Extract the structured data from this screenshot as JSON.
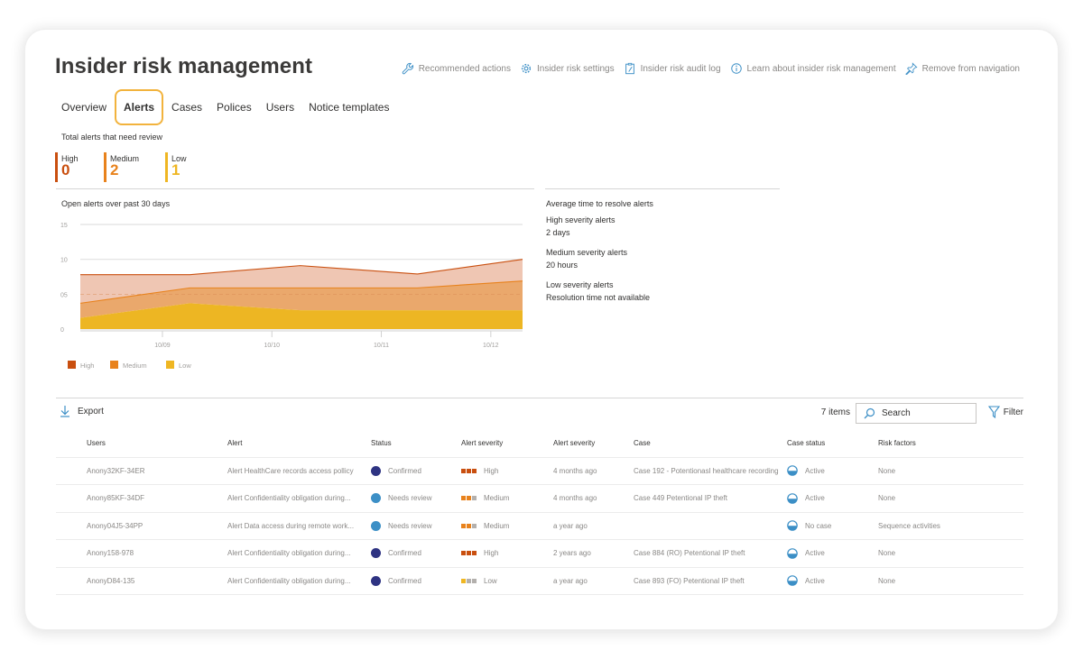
{
  "header": {
    "title": "Insider risk management",
    "actions": [
      {
        "label": "Recommended actions",
        "icon": "wrench-icon"
      },
      {
        "label": "Insider risk settings",
        "icon": "gear-icon"
      },
      {
        "label": "Insider risk audit log",
        "icon": "clipboard-icon"
      },
      {
        "label": "Learn about insider risk management",
        "icon": "info-icon"
      },
      {
        "label": "Remove from navigation",
        "icon": "pin-icon"
      }
    ]
  },
  "tabs": [
    {
      "label": "Overview",
      "active": false
    },
    {
      "label": "Alerts",
      "active": true
    },
    {
      "label": "Cases",
      "active": false
    },
    {
      "label": "Polices",
      "active": false
    },
    {
      "label": "Users",
      "active": false
    },
    {
      "label": "Notice templates",
      "active": false
    }
  ],
  "totals": {
    "title": "Total alerts that need review",
    "high": {
      "label": "High",
      "value": "0"
    },
    "medium": {
      "label": "Medium",
      "value": "2"
    },
    "low": {
      "label": "Low",
      "value": "1"
    }
  },
  "colors": {
    "high": "#c94f0f",
    "medium": "#e8821c",
    "low": "#efb622",
    "confirmed": "#2e3382",
    "needs_review": "#3c8fc6",
    "accent_tab": "#f2b33d"
  },
  "chart_data": {
    "type": "area",
    "stacked": true,
    "title": "Open alerts over past 30 days",
    "xlabel": "",
    "ylabel": "",
    "x_ticks": [
      "10/09",
      "10/10",
      "10/11",
      "10/12"
    ],
    "x_tick_days": [
      1,
      2,
      3,
      4
    ],
    "x": [
      0.25,
      1.25,
      2.26,
      3.33,
      4.29
    ],
    "xlim": [
      0.25,
      4.29
    ],
    "y_ticks": [
      "0",
      "05",
      "10",
      "15"
    ],
    "y_tick_values": [
      0,
      5,
      10,
      15
    ],
    "ylim": [
      0,
      15
    ],
    "grid": true,
    "legend_position": "bottom-left",
    "series": [
      {
        "name": "Low",
        "values": [
          1.6,
          3.7,
          2.7,
          2.7,
          2.7
        ]
      },
      {
        "name": "Medium",
        "values": [
          2.1,
          2.2,
          3.2,
          3.2,
          4.2
        ]
      },
      {
        "name": "High",
        "values": [
          4.1,
          1.9,
          3.2,
          2.0,
          3.1
        ]
      }
    ],
    "legend": [
      "High",
      "Medium",
      "Low"
    ]
  },
  "resolve": {
    "heading": "Average time to resolve alerts",
    "items": [
      {
        "title": "High severity alerts",
        "value": "2 days"
      },
      {
        "title": "Medium severity alerts",
        "value": "20 hours"
      },
      {
        "title": "Low severity alerts",
        "value": "Resolution time not available"
      }
    ]
  },
  "toolbar": {
    "export_label": "Export",
    "items_count": "7 items",
    "search_placeholder": "Search",
    "filter_label": "Filter"
  },
  "table": {
    "columns": [
      "Users",
      "Alert",
      "Status",
      "Alert severity",
      "Alert severity",
      "Case",
      "Case status",
      "Risk factors"
    ],
    "rows": [
      {
        "user": "Anony32KF-34ER",
        "alert": "Alert HealthCare records access pollicy",
        "status": "Confirmed",
        "severity": "High",
        "age": "4 months ago",
        "case": "Case 192 - Potentionasl healthcare recording",
        "case_status": "Active",
        "risk": "None"
      },
      {
        "user": "Anony85KF-34DF",
        "alert": "Alert Confidentiality obligation during...",
        "status": "Needs review",
        "severity": "Medium",
        "age": "4 months ago",
        "case": "Case 449 Petentional IP theft",
        "case_status": "Active",
        "risk": "None"
      },
      {
        "user": "Anony04J5-34PP",
        "alert": "Alert Data access during remote work...",
        "status": "Needs review",
        "severity": "Medium",
        "age": "a year ago",
        "case": "",
        "case_status": "No case",
        "risk": "Sequence activities"
      },
      {
        "user": "Anony158-978",
        "alert": "Alert Confidentiality obligation during...",
        "status": "Confirmed",
        "severity": "High",
        "age": "2 years ago",
        "case": "Case 884 (RO) Petentional IP theft",
        "case_status": "Active",
        "risk": "None"
      },
      {
        "user": "AnonyD84-135",
        "alert": "Alert Confidentiality obligation during...",
        "status": "Confirmed",
        "severity": "Low",
        "age": "a year ago",
        "case": "Case 893 (FO) Petentional IP theft",
        "case_status": "Active",
        "risk": "None"
      }
    ]
  }
}
